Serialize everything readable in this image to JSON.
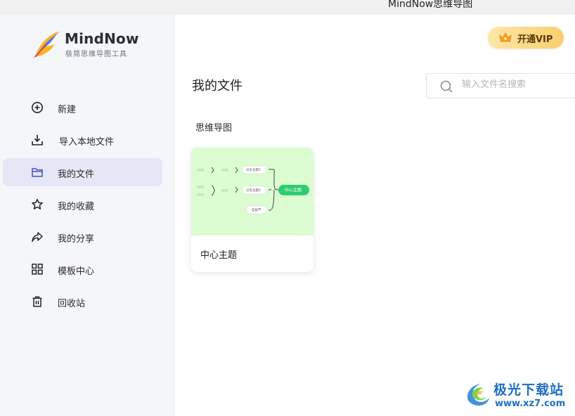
{
  "window": {
    "title": "MindNow思维导图"
  },
  "brand": {
    "name": "MindNow",
    "tagline": "极简思维导图工具"
  },
  "sidebar": {
    "items": [
      {
        "label": "新建",
        "icon": "plus-circle-icon",
        "active": false
      },
      {
        "label": "导入本地文件",
        "icon": "import-download-icon",
        "active": false
      },
      {
        "label": "我的文件",
        "icon": "folder-icon",
        "active": true
      },
      {
        "label": "我的收藏",
        "icon": "star-icon",
        "active": false
      },
      {
        "label": "我的分享",
        "icon": "share-arrow-icon",
        "active": false
      },
      {
        "label": "模板中心",
        "icon": "grid-icon",
        "active": false
      },
      {
        "label": "回收站",
        "icon": "trash-icon",
        "active": false
      }
    ]
  },
  "header": {
    "vip_label": "开通VIP"
  },
  "main": {
    "title": "我的文件",
    "search": {
      "placeholder": "输入文件名搜索",
      "value": ""
    },
    "section_label": "思维导图",
    "files": [
      {
        "name": "中心主题",
        "thumbnail": {
          "center": "中心主题",
          "branches": [
            "分支主题1",
            "分支主题2",
            "自由节"
          ],
          "background": "#dcfdd2",
          "accent": "#2ecc71"
        }
      }
    ]
  },
  "watermark": {
    "line1": "极光下载站",
    "line2": "www.xz7.com"
  },
  "colors": {
    "accent": "#5b5fc7",
    "sidebar_bg": "#f5f6fa",
    "active_item_bg": "#e5e6f6",
    "vip_gold": "#f8cf6e"
  }
}
